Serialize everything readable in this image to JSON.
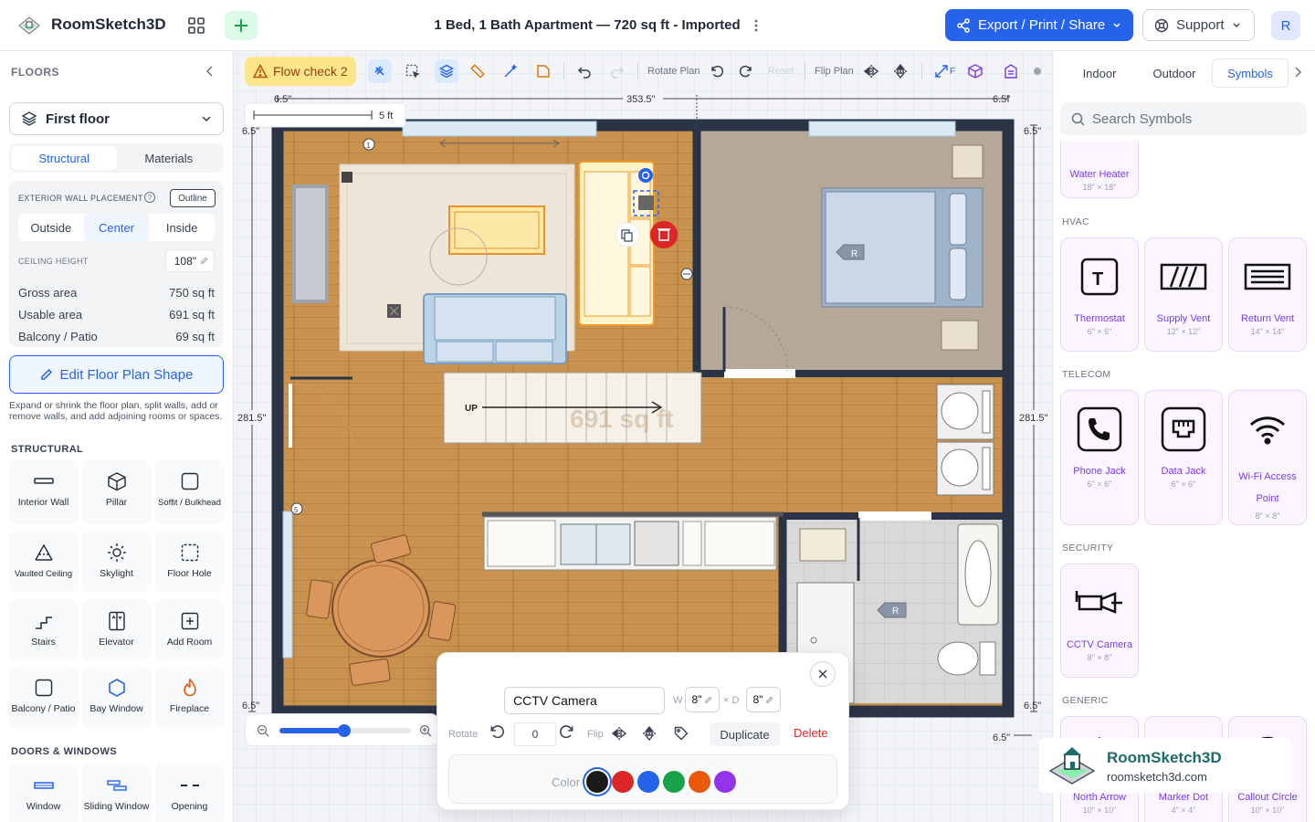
{
  "app": {
    "name": "RoomSketch3D"
  },
  "header": {
    "doc_title": "1 Bed, 1 Bath Apartment — 720 sq ft - Imported",
    "export_label": "Export / Print / Share",
    "support_label": "Support",
    "avatar_initial": "R"
  },
  "left": {
    "floors_heading": "FLOORS",
    "floor_selected": "First floor",
    "tabs": [
      "Structural",
      "Materials"
    ],
    "wall_placement_label": "EXTERIOR WALL PLACEMENT",
    "outline_label": "Outline",
    "placement_options": [
      "Outside",
      "Center",
      "Inside"
    ],
    "placement_selected": "Center",
    "ceiling_label": "CEILING HEIGHT",
    "ceiling_value": "108\"",
    "areas": [
      {
        "label": "Gross area",
        "value": "750 sq ft"
      },
      {
        "label": "Usable area",
        "value": "691 sq ft"
      },
      {
        "label": "Balcony / Patio",
        "value": "69 sq ft"
      }
    ],
    "edit_shape_label": "Edit Floor Plan Shape",
    "edit_shape_help": "Expand or shrink the floor plan, split walls, add or remove walls, and add adjoining rooms or spaces.",
    "structural_heading": "STRUCTURAL",
    "tools": [
      {
        "label": "Interior Wall",
        "icon": "wall-icon"
      },
      {
        "label": "Pillar",
        "icon": "cube-icon"
      },
      {
        "label": "Soffit / Bulkhead",
        "icon": "soffit-icon"
      },
      {
        "label": "Vaulted Ceiling",
        "icon": "vaulted-icon"
      },
      {
        "label": "Skylight",
        "icon": "sun-icon"
      },
      {
        "label": "Floor Hole",
        "icon": "dashed-square-icon"
      },
      {
        "label": "Stairs",
        "icon": "stairs-icon"
      },
      {
        "label": "Elevator",
        "icon": "elevator-icon"
      },
      {
        "label": "Add Room",
        "icon": "plus-square-icon"
      },
      {
        "label": "Balcony / Patio",
        "icon": "balcony-icon"
      },
      {
        "label": "Bay Window",
        "icon": "hexagon-icon"
      },
      {
        "label": "Fireplace",
        "icon": "flame-icon"
      }
    ],
    "doors_heading": "DOORS & WINDOWS",
    "door_tools": [
      {
        "label": "Window",
        "icon": "window-icon"
      },
      {
        "label": "Sliding Window",
        "icon": "sliding-window-icon"
      },
      {
        "label": "Opening",
        "icon": "opening-icon"
      }
    ]
  },
  "toolbar": {
    "flow_check": "Flow check 2",
    "rotate_plan": "Rotate Plan",
    "reset": "Reset",
    "flip_plan": "Flip Plan",
    "fit_label": "F"
  },
  "plan": {
    "dim_top_left": "6.5\"",
    "dim_top_mid": "353.5\"",
    "dim_top_right": "6.5\"",
    "dim_side_left": "281.5\"",
    "dim_side_right": "281.5\"",
    "dim_corner": "6.5\"",
    "scale_label": "5 ft",
    "stairs_label": "UP",
    "area_watermark": "691 sq ft",
    "marker_r": "R",
    "marker_1": "1",
    "marker_5": "5"
  },
  "popup": {
    "name_value": "CCTV Camera",
    "w_label": "W",
    "w_value": "8\"",
    "d_label": "× D",
    "d_value": "8\"",
    "rotate_label": "Rotate",
    "rotate_value": "0",
    "flip_label": "Flip",
    "duplicate_label": "Duplicate",
    "delete_label": "Delete",
    "color_label": "Color",
    "colors": [
      "#1a1a1a",
      "#dc2626",
      "#2563eb",
      "#16a34a",
      "#ea580c",
      "#9333ea"
    ]
  },
  "right": {
    "tabs": [
      "Indoor",
      "Outdoor",
      "Symbols"
    ],
    "tab_selected": "Symbols",
    "search_placeholder": "Search Symbols",
    "water_heater": {
      "name": "Water Heater",
      "size": "18\" × 18\""
    },
    "sections": {
      "hvac": "HVAC",
      "telecom": "TELECOM",
      "security": "SECURITY",
      "generic": "GENERIC"
    },
    "hvac_items": [
      {
        "name": "Thermostat",
        "size": "6\" × 6\""
      },
      {
        "name": "Supply Vent",
        "size": "12\" × 12\""
      },
      {
        "name": "Return Vent",
        "size": "14\" × 14\""
      }
    ],
    "telecom_items": [
      {
        "name": "Phone Jack",
        "size": "6\" × 6\""
      },
      {
        "name": "Data Jack",
        "size": "6\" × 6\""
      },
      {
        "name": "Wi-Fi Access Point",
        "size": "8\" × 8\""
      }
    ],
    "security_items": [
      {
        "name": "CCTV Camera",
        "size": "8\" × 8\""
      }
    ],
    "generic_items": [
      {
        "name": "North Arrow",
        "size": "10\" × 10\""
      },
      {
        "name": "Marker Dot",
        "size": "4\" × 4\""
      },
      {
        "name": "Callout Circle",
        "size": "10\" × 10\""
      }
    ]
  },
  "watermark": {
    "title": "RoomSketch3D",
    "url": "roomsketch3d.com"
  }
}
